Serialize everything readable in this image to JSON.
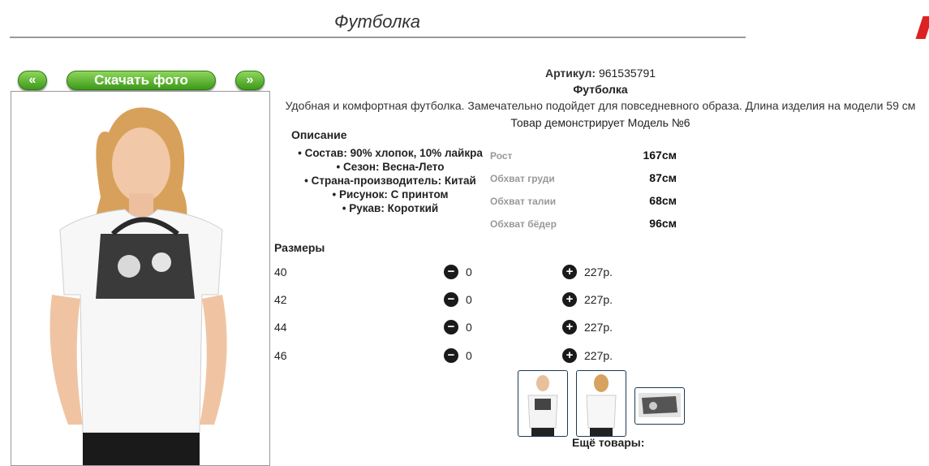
{
  "title": "Футболка",
  "nav": {
    "prev_label": "«",
    "download_label": "Скачать фото",
    "next_label": "»"
  },
  "article": {
    "label": "Артикул:",
    "value": "961535791"
  },
  "product": {
    "name": "Футболка",
    "description": "Удобная и комфортная футболка. Замечательно подойдет для повседневного образа. Длина изделия на модели 59 см",
    "model_line": "Товар демонстрирует Модель №6"
  },
  "description_heading": "Описание",
  "attributes": [
    "Состав: 90% хлопок, 10% лайкра",
    "Сезон: Весна-Лето",
    "Страна-производитель: Китай",
    "Рисунок: С принтом",
    "Рукав: Короткий"
  ],
  "measurements": [
    {
      "label": "Рост",
      "value": "167см"
    },
    {
      "label": "Обхват груди",
      "value": "87см"
    },
    {
      "label": "Обхват талии",
      "value": "68см"
    },
    {
      "label": "Обхват бёдер",
      "value": "96см"
    }
  ],
  "sizes_heading": "Размеры",
  "sizes": [
    {
      "size": "40",
      "qty": "0",
      "price": "227р."
    },
    {
      "size": "42",
      "qty": "0",
      "price": "227р."
    },
    {
      "size": "44",
      "qty": "0",
      "price": "227р."
    },
    {
      "size": "46",
      "qty": "0",
      "price": "227р."
    }
  ],
  "more_products_label": "Ещё товары:",
  "colors": {
    "button_green": "#3c9a1a",
    "close_red": "#d22222"
  }
}
